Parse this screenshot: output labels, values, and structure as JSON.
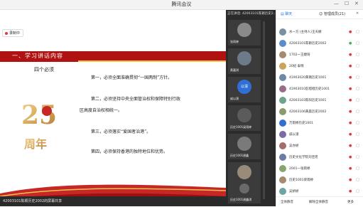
{
  "window": {
    "title": "腾讯会议"
  },
  "recording": {
    "label": "录制中"
  },
  "slide": {
    "section_title": "一、学习讲话内容",
    "subtitle": "四个必须",
    "items": [
      "第一，必须全面准确贯彻“一国两制”方针。",
      "第二，必须坚持中央全面管治权和保障特别行政",
      "区高度自治权相统一。",
      "第三，必须落实“爱国者治港”。",
      "第四，必须保持香港的独特地位和优势。"
    ],
    "logo_text": "25周年"
  },
  "statusbar": {
    "text": "42003101陈颖历史2002的屏幕共享"
  },
  "thumbs": {
    "header": "正在讲话: 42003101陈颖历史2...",
    "tiles": [
      {
        "name": "张雨婷",
        "avatar_color": "#8a8a8a"
      },
      {
        "name": "黄嘉琪",
        "avatar_color": "#6c7a89"
      },
      {
        "name": "戚以濛",
        "avatar_color": "#2f6fd6",
        "initials": "以濛"
      },
      {
        "name": "历史1001梁雨婷",
        "avatar_color": "#5b5b5b"
      },
      {
        "name": "历史1001谢鑫",
        "avatar_color": "#7a7a7a"
      },
      {
        "name": "1702一王婕琦",
        "avatar_color": "#9a8a7a"
      },
      {
        "name": "历史1001谢鑫琪",
        "avatar_color": "#6a6a6a"
      }
    ]
  },
  "panel": {
    "tabs": [
      "聊天",
      "管理成员(21)"
    ],
    "members": [
      {
        "name": "水一方 (主持人)王天娜",
        "color": "#7b8ea3"
      },
      {
        "name": "42003101陈颖历史2002",
        "color": "#5b8cc9"
      },
      {
        "name": "1702一王婕琦",
        "color": "#a58b6c"
      },
      {
        "name": "20纪 泰晓",
        "color": "#c9a55b"
      },
      {
        "name": "41903020黄璐历史1001",
        "color": "#6c8aa5"
      },
      {
        "name": "41903010彭旭旭历史1001",
        "color": "#9a6c8a"
      },
      {
        "name": "42003103陈阳历史1001",
        "color": "#6ca58a"
      },
      {
        "name": "42003106黄晨历史2002",
        "color": "#8a9a6c"
      },
      {
        "name": "万雨婷历史1001",
        "color": "#2f6fd6"
      },
      {
        "name": "戚以濛",
        "color": "#7a6ca5"
      },
      {
        "name": "吴亦娇",
        "color": "#a56c6c"
      },
      {
        "name": "历史文化学院刘佳瑶",
        "color": "#6c7aa5"
      },
      {
        "name": "2001一张雨婷",
        "color": "#8aa56c"
      },
      {
        "name": "历史1001梁雨婷",
        "color": "#a58a6c"
      },
      {
        "name": "吴娇娇",
        "color": "#6ca5a5"
      }
    ],
    "buttons": [
      "全体静音",
      "解除全体静音",
      "更多"
    ]
  },
  "colors": {
    "red": "#b01212",
    "gold": "#f2c14e"
  }
}
